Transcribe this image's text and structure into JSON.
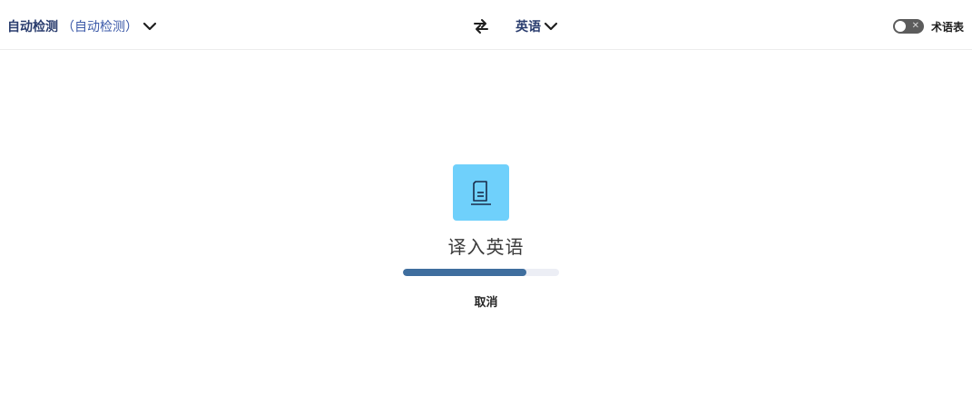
{
  "header": {
    "source_language": "自动检测",
    "source_language_detected": "（自动检测）",
    "target_language": "英语",
    "glossary_label": "术语表",
    "glossary_enabled": false
  },
  "main": {
    "status_text": "译入英语",
    "progress": 0.79,
    "cancel_label": "取消"
  },
  "icons": {
    "source_dropdown": "chevron-down-icon",
    "swap": "swap-arrows-icon",
    "target_dropdown": "chevron-down-icon",
    "document": "document-icon"
  },
  "colors": {
    "language_text": "#2a3d6e",
    "document_tile": "#6fd0fb",
    "progress_fill": "#3f6e9e",
    "progress_track": "#eceef5",
    "toggle_off": "#5c5c5c"
  }
}
